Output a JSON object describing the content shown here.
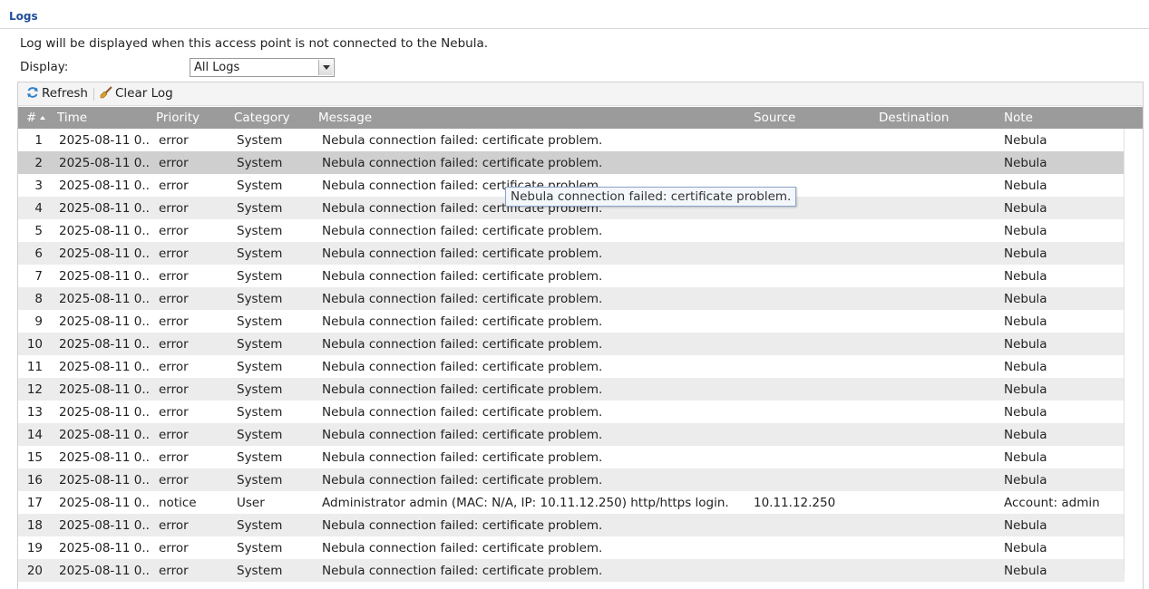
{
  "section": {
    "title": "Logs"
  },
  "info_text": "Log will be displayed when this access point is not connected to the Nebula.",
  "display": {
    "label": "Display:",
    "selected": "All Logs"
  },
  "toolbar": {
    "refresh_label": "Refresh",
    "clear_label": "Clear Log"
  },
  "columns": {
    "num": "#",
    "time": "Time",
    "priority": "Priority",
    "category": "Category",
    "message": "Message",
    "source": "Source",
    "destination": "Destination",
    "note": "Note"
  },
  "tooltip": "Nebula connection failed: certificate problem.",
  "rows": [
    {
      "num": "1",
      "time": "2025-08-11 0...",
      "priority": "error",
      "category": "System",
      "message": "Nebula connection failed: certificate problem.",
      "source": "",
      "destination": "",
      "note": "Nebula"
    },
    {
      "num": "2",
      "time": "2025-08-11 0...",
      "priority": "error",
      "category": "System",
      "message": "Nebula connection failed: certificate problem.",
      "source": "",
      "destination": "",
      "note": "Nebula"
    },
    {
      "num": "3",
      "time": "2025-08-11 0...",
      "priority": "error",
      "category": "System",
      "message": "Nebula connection failed: certificate problem.",
      "source": "",
      "destination": "",
      "note": "Nebula"
    },
    {
      "num": "4",
      "time": "2025-08-11 0...",
      "priority": "error",
      "category": "System",
      "message": "Nebula connection failed: certificate problem.",
      "source": "",
      "destination": "",
      "note": "Nebula"
    },
    {
      "num": "5",
      "time": "2025-08-11 0...",
      "priority": "error",
      "category": "System",
      "message": "Nebula connection failed: certificate problem.",
      "source": "",
      "destination": "",
      "note": "Nebula"
    },
    {
      "num": "6",
      "time": "2025-08-11 0...",
      "priority": "error",
      "category": "System",
      "message": "Nebula connection failed: certificate problem.",
      "source": "",
      "destination": "",
      "note": "Nebula"
    },
    {
      "num": "7",
      "time": "2025-08-11 0...",
      "priority": "error",
      "category": "System",
      "message": "Nebula connection failed: certificate problem.",
      "source": "",
      "destination": "",
      "note": "Nebula"
    },
    {
      "num": "8",
      "time": "2025-08-11 0...",
      "priority": "error",
      "category": "System",
      "message": "Nebula connection failed: certificate problem.",
      "source": "",
      "destination": "",
      "note": "Nebula"
    },
    {
      "num": "9",
      "time": "2025-08-11 0...",
      "priority": "error",
      "category": "System",
      "message": "Nebula connection failed: certificate problem.",
      "source": "",
      "destination": "",
      "note": "Nebula"
    },
    {
      "num": "10",
      "time": "2025-08-11 0...",
      "priority": "error",
      "category": "System",
      "message": "Nebula connection failed: certificate problem.",
      "source": "",
      "destination": "",
      "note": "Nebula"
    },
    {
      "num": "11",
      "time": "2025-08-11 0...",
      "priority": "error",
      "category": "System",
      "message": "Nebula connection failed: certificate problem.",
      "source": "",
      "destination": "",
      "note": "Nebula"
    },
    {
      "num": "12",
      "time": "2025-08-11 0...",
      "priority": "error",
      "category": "System",
      "message": "Nebula connection failed: certificate problem.",
      "source": "",
      "destination": "",
      "note": "Nebula"
    },
    {
      "num": "13",
      "time": "2025-08-11 0...",
      "priority": "error",
      "category": "System",
      "message": "Nebula connection failed: certificate problem.",
      "source": "",
      "destination": "",
      "note": "Nebula"
    },
    {
      "num": "14",
      "time": "2025-08-11 0...",
      "priority": "error",
      "category": "System",
      "message": "Nebula connection failed: certificate problem.",
      "source": "",
      "destination": "",
      "note": "Nebula"
    },
    {
      "num": "15",
      "time": "2025-08-11 0...",
      "priority": "error",
      "category": "System",
      "message": "Nebula connection failed: certificate problem.",
      "source": "",
      "destination": "",
      "note": "Nebula"
    },
    {
      "num": "16",
      "time": "2025-08-11 0...",
      "priority": "error",
      "category": "System",
      "message": "Nebula connection failed: certificate problem.",
      "source": "",
      "destination": "",
      "note": "Nebula"
    },
    {
      "num": "17",
      "time": "2025-08-11 0...",
      "priority": "notice",
      "category": "User",
      "message": "Administrator admin (MAC: N/A, IP: 10.11.12.250) http/https login.",
      "source": "10.11.12.250",
      "destination": "",
      "note": "Account: admin"
    },
    {
      "num": "18",
      "time": "2025-08-11 0...",
      "priority": "error",
      "category": "System",
      "message": "Nebula connection failed: certificate problem.",
      "source": "",
      "destination": "",
      "note": "Nebula"
    },
    {
      "num": "19",
      "time": "2025-08-11 0...",
      "priority": "error",
      "category": "System",
      "message": "Nebula connection failed: certificate problem.",
      "source": "",
      "destination": "",
      "note": "Nebula"
    },
    {
      "num": "20",
      "time": "2025-08-11 0...",
      "priority": "error",
      "category": "System",
      "message": "Nebula connection failed: certificate problem.",
      "source": "",
      "destination": "",
      "note": "Nebula"
    }
  ],
  "selected_row": 2,
  "colors": {
    "header_bg": "#9b9b9b",
    "row_alt": "#ececec",
    "row_selected": "#cfcfcf",
    "title": "#1f4e9b"
  },
  "icons": {
    "refresh": "refresh-icon",
    "clear": "broom-icon",
    "sort": "sort-ascending-icon",
    "dropdown": "chevron-down-icon"
  }
}
